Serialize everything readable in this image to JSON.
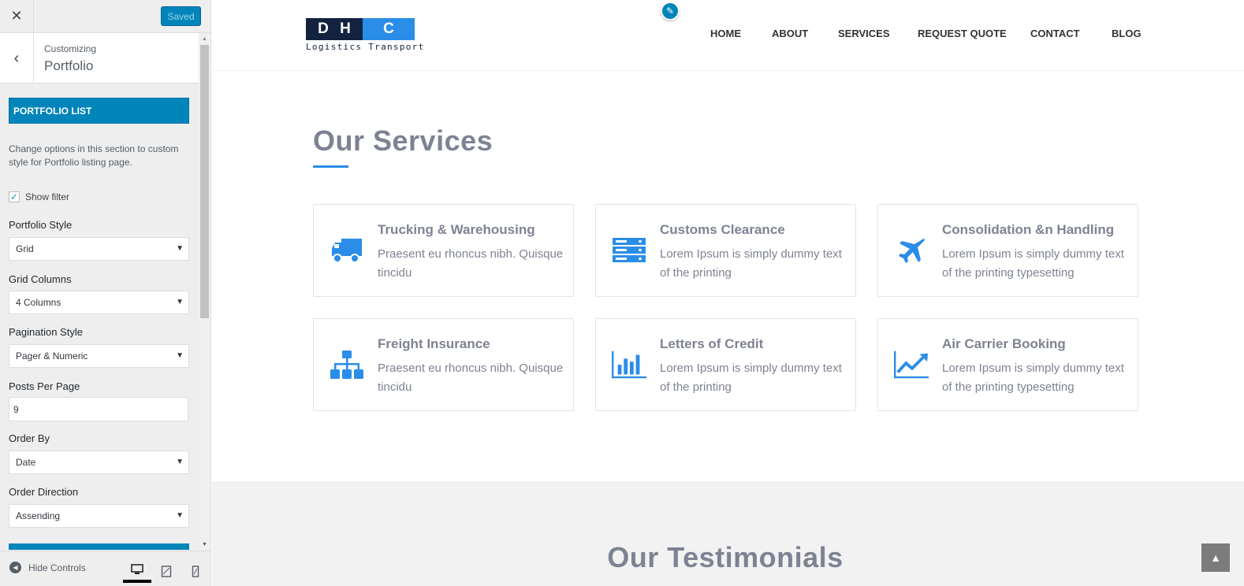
{
  "customizer": {
    "close_icon": "close-icon",
    "saved_label": "Saved",
    "breadcrumb": "Customizing",
    "section_title": "Portfolio",
    "band_label": "PORTFOLIO LIST",
    "description": "Change options in this section to custom style for Portfolio listing page.",
    "show_filter_label": "Show filter",
    "show_filter_checked": true,
    "fields": {
      "portfolio_style": {
        "label": "Portfolio Style",
        "value": "Grid"
      },
      "grid_columns": {
        "label": "Grid Columns",
        "value": "4 Columns"
      },
      "pagination_style": {
        "label": "Pagination Style",
        "value": "Pager & Numeric"
      },
      "posts_per_page": {
        "label": "Posts Per Page",
        "value": "9"
      },
      "order_by": {
        "label": "Order By",
        "value": "Date"
      },
      "order_direction": {
        "label": "Order Direction",
        "value": "Assending"
      }
    },
    "footer": {
      "hide_controls_label": "Hide Controls",
      "devices": [
        "desktop",
        "tablet",
        "mobile"
      ]
    }
  },
  "site": {
    "logo": {
      "letters": [
        "D",
        "H",
        "C"
      ],
      "tagline": "Logistics Transport"
    },
    "nav": [
      "HOME",
      "ABOUT",
      "SERVICES",
      "REQUEST QUOTE",
      "CONTACT",
      "BLOG"
    ],
    "services_title": "Our Services",
    "services": [
      {
        "icon": "truck-icon",
        "title": "Trucking & Warehousing",
        "text": "Praesent eu rhoncus nibh. Quisque tincidu"
      },
      {
        "icon": "server-icon",
        "title": "Customs Clearance",
        "text": "Lorem Ipsum is simply dummy text of the printing"
      },
      {
        "icon": "plane-icon",
        "title": "Consolidation &n Handling",
        "text": "Lorem Ipsum is simply dummy text of the printing typesetting"
      },
      {
        "icon": "sitemap-icon",
        "title": "Freight Insurance",
        "text": "Praesent eu rhoncus nibh. Quisque tincidu"
      },
      {
        "icon": "bar-chart-icon",
        "title": "Letters of Credit",
        "text": "Lorem Ipsum is simply dummy text of the printing"
      },
      {
        "icon": "line-chart-icon",
        "title": "Air Carrier Booking",
        "text": "Lorem Ipsum is simply dummy text of the printing typesetting"
      }
    ],
    "testimonials_title": "Our Testimonials",
    "accent_color": "#2a8de8",
    "heading_color": "#7e8393"
  }
}
